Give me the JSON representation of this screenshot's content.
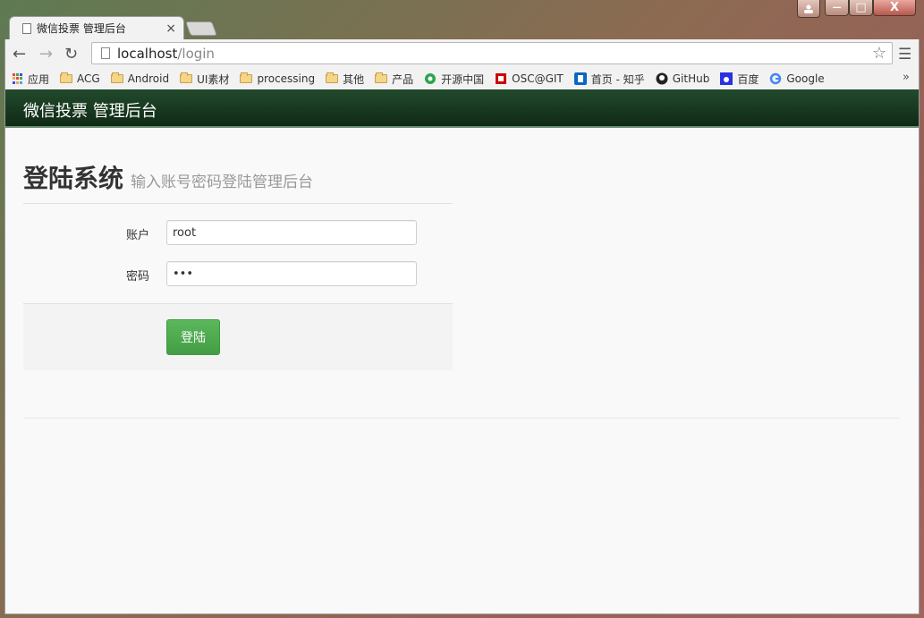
{
  "browser": {
    "tab_title": "微信投票 管理后台",
    "tab_close": "×",
    "url_host": "localhost",
    "url_path": "/login",
    "window_controls": {
      "minimize": "—",
      "maximize": "□",
      "close": "X"
    },
    "bookmarks": [
      {
        "label": "应用",
        "icon": "apps-icon"
      },
      {
        "label": "ACG",
        "icon": "folder-icon"
      },
      {
        "label": "Android",
        "icon": "folder-icon"
      },
      {
        "label": "UI素材",
        "icon": "folder-icon"
      },
      {
        "label": "processing",
        "icon": "folder-icon"
      },
      {
        "label": "其他",
        "icon": "folder-icon"
      },
      {
        "label": "产品",
        "icon": "folder-icon"
      },
      {
        "label": "开源中国",
        "icon": "oschina-icon"
      },
      {
        "label": "OSC@GIT",
        "icon": "oscgit-icon"
      },
      {
        "label": "首页 - 知乎",
        "icon": "zhihu-icon"
      },
      {
        "label": "GitHub",
        "icon": "github-icon"
      },
      {
        "label": "百度",
        "icon": "baidu-icon"
      },
      {
        "label": "Google",
        "icon": "google-icon"
      }
    ],
    "more": "»"
  },
  "app": {
    "brand": "微信投票 管理后台",
    "heading": "登陆系统",
    "subheading": "输入账号密码登陆管理后台",
    "form": {
      "account_label": "账户",
      "account_value": "root",
      "password_label": "密码",
      "password_value": "•••",
      "submit_label": "登陆"
    }
  },
  "colors": {
    "navbar": "#1a3d22",
    "button": "#5cb85c"
  }
}
